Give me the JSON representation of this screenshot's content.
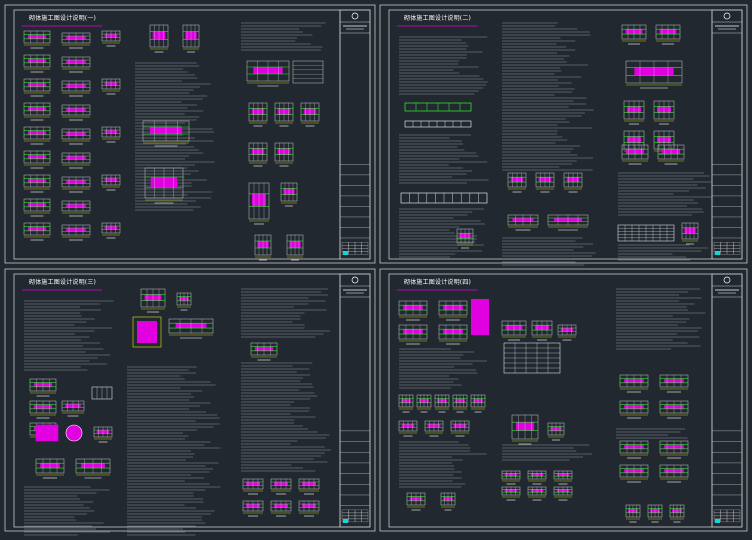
{
  "drawing_set": {
    "background_color": "#212830",
    "line_color": "#c8c8c8",
    "accent_colors": {
      "magenta": "#e000e0",
      "green": "#33dd33",
      "yellow": "#e8e800",
      "cyan": "#00e0e0",
      "white": "#ffffff"
    },
    "sheets": [
      {
        "id": "sheet-top-left",
        "title": "砌体施工图设计说明(一)"
      },
      {
        "id": "sheet-top-right",
        "title": "砌体施工图设计说明(二)"
      },
      {
        "id": "sheet-bottom-left",
        "title": "砌体施工图设计说明(三)"
      },
      {
        "id": "sheet-bottom-right",
        "title": "砌体施工图设计说明(四)"
      }
    ],
    "title_block": {
      "field_count": 7,
      "logo_icon": "circle-stamp-icon"
    }
  }
}
